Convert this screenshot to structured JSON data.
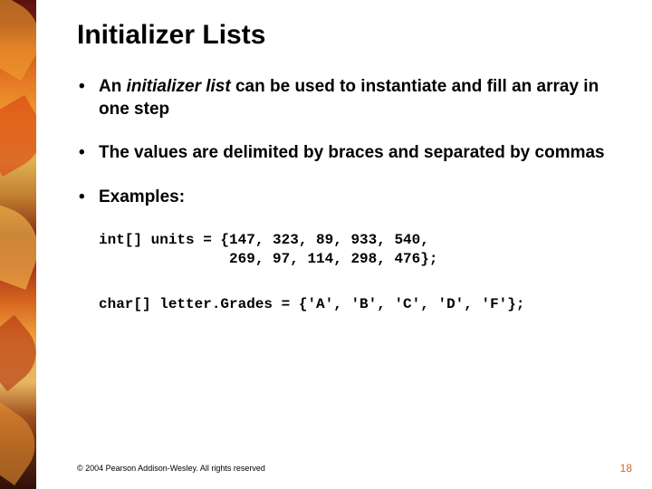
{
  "title": "Initializer Lists",
  "bullets": [
    {
      "pre": "An ",
      "em": "initializer list",
      "post": " can be used to instantiate and fill an array in one step"
    },
    {
      "pre": "The values are delimited by braces and separated by commas",
      "em": "",
      "post": ""
    },
    {
      "pre": "Examples:",
      "em": "",
      "post": ""
    }
  ],
  "code1": "int[] units = {147, 323, 89, 933, 540,\n               269, 97, 114, 298, 476};",
  "code2": "char[] letter.Grades = {'A', 'B', 'C', 'D', 'F'};",
  "footer": "© 2004 Pearson Addison-Wesley. All rights reserved",
  "page": "18"
}
